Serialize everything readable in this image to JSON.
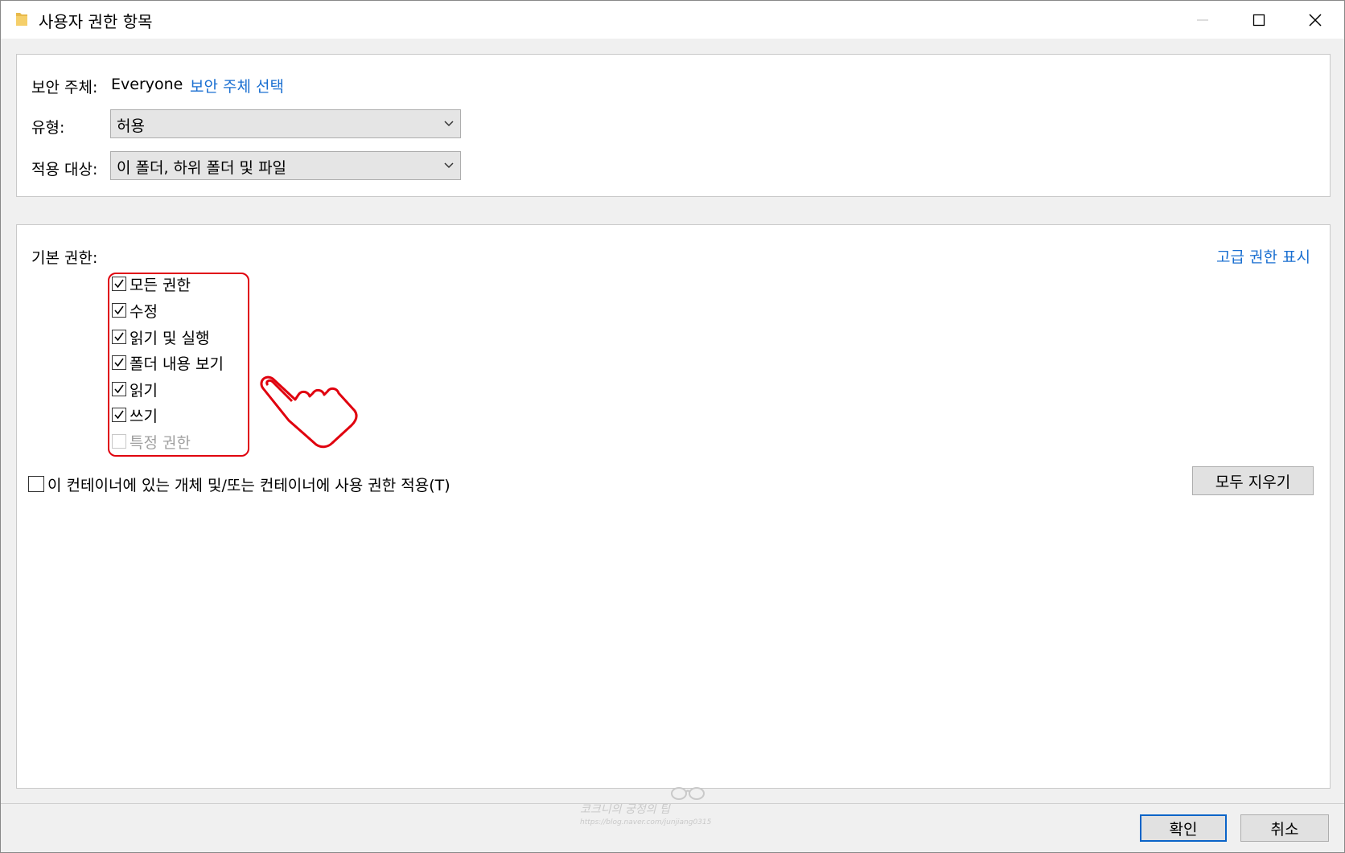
{
  "window": {
    "title": "사용자 권한 항목"
  },
  "principal": {
    "label": "보안 주체:",
    "value": "Everyone",
    "select_link": "보안 주체 선택"
  },
  "type": {
    "label": "유형:",
    "value": "허용"
  },
  "applies_to": {
    "label": "적용 대상:",
    "value": "이 폴더, 하위 폴더 및 파일"
  },
  "basic_permissions": {
    "label": "기본 권한:",
    "advanced_link": "고급 권한 표시",
    "items": [
      {
        "label": "모든 권한",
        "checked": true,
        "enabled": true
      },
      {
        "label": "수정",
        "checked": true,
        "enabled": true
      },
      {
        "label": "읽기 및 실행",
        "checked": true,
        "enabled": true
      },
      {
        "label": "폴더 내용 보기",
        "checked": true,
        "enabled": true
      },
      {
        "label": "읽기",
        "checked": true,
        "enabled": true
      },
      {
        "label": "쓰기",
        "checked": true,
        "enabled": true
      },
      {
        "label": "특정 권한",
        "checked": false,
        "enabled": false
      }
    ]
  },
  "apply_container": {
    "label": "이 컨테이너에 있는 개체 및/또는 컨테이너에 사용 권한 적용(T)",
    "checked": false
  },
  "clear_all_button": "모두 지우기",
  "ok_button": "확인",
  "cancel_button": "취소",
  "watermark": {
    "title": "코크니의 궁정의 팁",
    "url": "https://blog.naver.com/junjiang0315"
  },
  "colors": {
    "link": "#1a6fd1",
    "highlight": "#e0000e",
    "panel_bg": "#ffffff",
    "window_bg": "#f0f0f0"
  }
}
